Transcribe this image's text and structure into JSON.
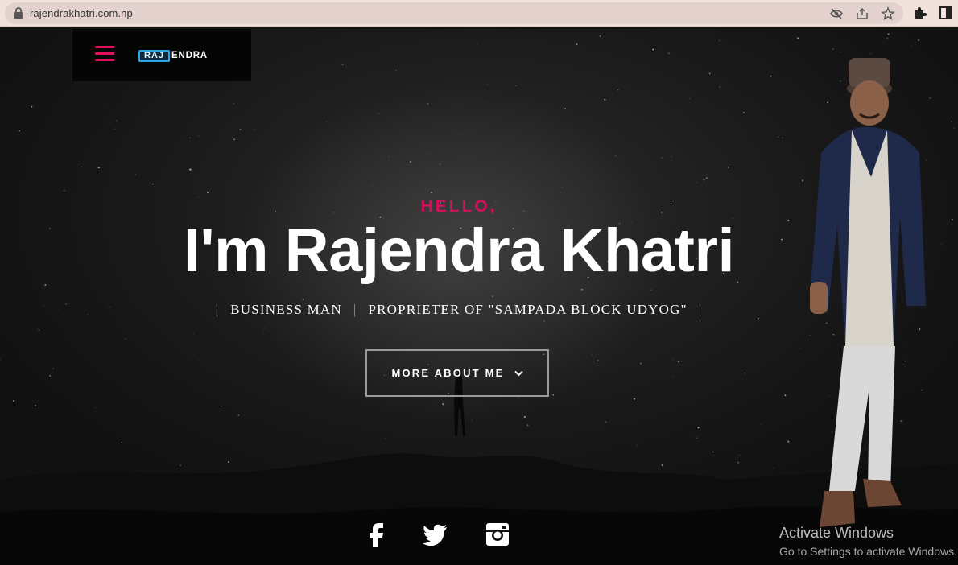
{
  "browser": {
    "url": "rajendrakhatri.com.np"
  },
  "nav": {
    "menu_icon": "hamburger-icon",
    "logo_boxed": "RAJ",
    "logo_rest": "ENDRA"
  },
  "hero": {
    "greeting": "HELLO,",
    "headline": "I'm Rajendra Khatri",
    "roles": [
      "BUSINESS MAN",
      "PROPRIETER OF \"SAMPADA BLOCK UDYOG\""
    ],
    "separator": "|",
    "cta_label": "MORE ABOUT ME"
  },
  "social": [
    "facebook-icon",
    "twitter-icon",
    "instagram-icon"
  ],
  "windows_watermark": {
    "line1": "Activate Windows",
    "line2": "Go to Settings to activate Windows."
  },
  "colors": {
    "accent": "#d1105a",
    "background": "#121212",
    "chrome": "#f1e2de"
  }
}
